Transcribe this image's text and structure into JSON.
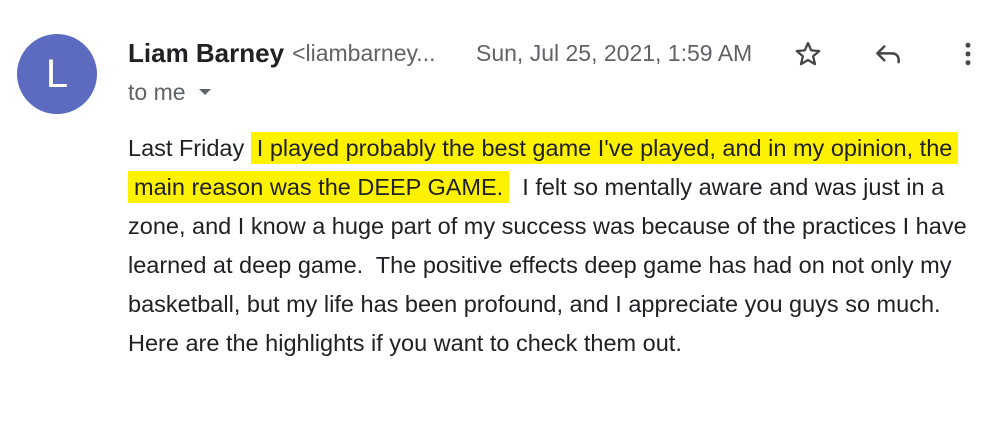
{
  "sender": {
    "avatar_letter": "L",
    "avatar_color": "#5c6bc0",
    "name": "Liam Barney",
    "email": "<liambarney..."
  },
  "date": "Sun, Jul 25, 2021, 1:59 AM",
  "recipient": "to me",
  "actions": {
    "star_icon": "star-icon",
    "reply_icon": "reply-icon",
    "more_icon": "more-vert-icon"
  },
  "message": {
    "lead": "Last Friday",
    "highlighted": "I played probably the best game I've played, and in my opinion, the main reason was the DEEP GAME.",
    "rest": "I felt so mentally aware and was just in a zone, and I know a huge part of my success was because of the practices I have learned at deep game.  The positive effects deep game has had on not only my basketball, but my life has been profound, and I appreciate you guys so much.  Here are the highlights if you want to check them out.",
    "highlight_color": "#fff200"
  }
}
